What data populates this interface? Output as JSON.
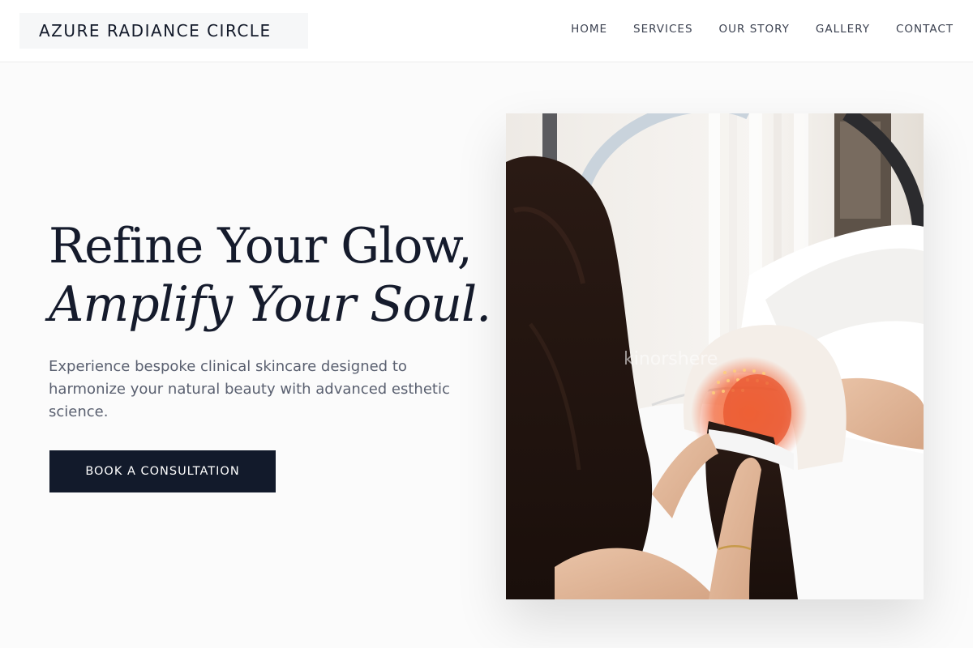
{
  "header": {
    "brand": "AZURE RADIANCE CIRCLE",
    "nav": [
      {
        "label": "HOME"
      },
      {
        "label": "SERVICES"
      },
      {
        "label": "OUR STORY"
      },
      {
        "label": "GALLERY"
      },
      {
        "label": "CONTACT"
      }
    ]
  },
  "hero": {
    "title_line1": "Refine Your Glow,",
    "title_line2": "Amplify Your Soul.",
    "description": "Experience bespoke clinical skincare designed to harmonize your natural beauty with advanced esthetic science.",
    "cta_label": "BOOK A CONSULTATION",
    "image": {
      "subject": "esthetician-performing-led-light-therapy-facial",
      "watermark": "kinorshere"
    }
  },
  "colors": {
    "brand_dark": "#121a2b",
    "text_body": "#5a6070",
    "page_bg": "#fbfbfb",
    "header_bg": "#ffffff"
  }
}
